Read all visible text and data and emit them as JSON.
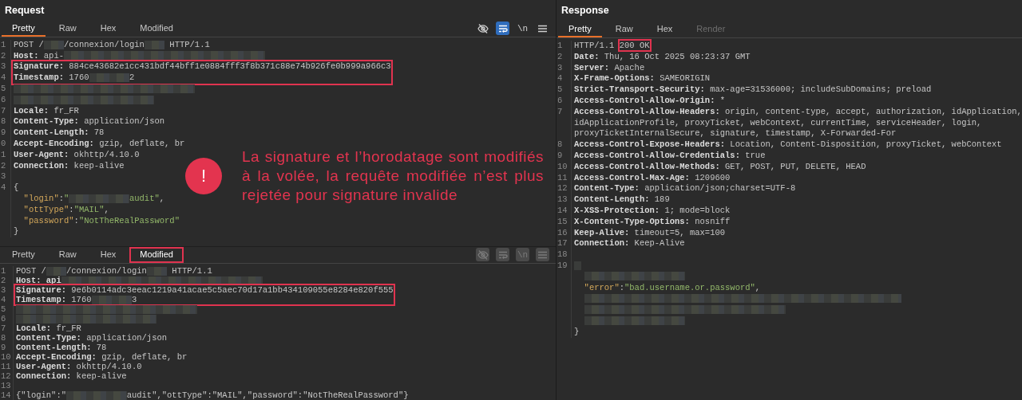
{
  "request": {
    "title": "Request",
    "tabs": [
      {
        "label": "Pretty",
        "selected": true,
        "highlighted": false
      },
      {
        "label": "Raw",
        "selected": false,
        "highlighted": false
      },
      {
        "label": "Hex",
        "selected": false,
        "highlighted": false
      },
      {
        "label": "Modified",
        "selected": false,
        "highlighted": false
      }
    ],
    "toolbar": {
      "disabled": false,
      "items": [
        {
          "kind": "eye_off",
          "active": false
        },
        {
          "kind": "wrap",
          "active": true
        },
        {
          "kind": "newline",
          "label": "\\n",
          "active": false
        },
        {
          "kind": "menu",
          "active": false
        }
      ]
    },
    "lines": [
      {
        "number": "1",
        "segments": [
          {
            "kind": "plain",
            "text": "POST /"
          },
          {
            "kind": "redacted_short"
          },
          {
            "kind": "plain",
            "text": "/connexion/login"
          },
          {
            "kind": "redacted_short"
          },
          {
            "kind": "plain",
            "text": " HTTP/1.1"
          }
        ]
      },
      {
        "number": "2",
        "segments": [
          {
            "kind": "name",
            "text": "Host:"
          },
          {
            "kind": "plain",
            "text": " api-"
          },
          {
            "kind": "redacted_huge"
          }
        ]
      },
      {
        "kind": "highlight_box",
        "lines": [
          {
            "number": "3",
            "segments": [
              {
                "kind": "name",
                "text": "Signature:"
              },
              {
                "kind": "plain",
                "text": " 884ce43682e1cc431bdf44bff1e0884fff3f8b371c88e74b926fe0b999a966c3"
              }
            ]
          },
          {
            "number": "4",
            "segments": [
              {
                "kind": "name",
                "text": "Timestamp:"
              },
              {
                "kind": "plain",
                "text": " 1760"
              },
              {
                "kind": "redacted_medium"
              },
              {
                "kind": "plain",
                "text": "2"
              }
            ]
          }
        ]
      },
      {
        "number": "5",
        "segments": [
          {
            "kind": "redacted_xwide"
          }
        ]
      },
      {
        "number": "6",
        "segments": [
          {
            "kind": "redacted_wide"
          }
        ]
      },
      {
        "number": "7",
        "segments": [
          {
            "kind": "name",
            "text": "Locale:"
          },
          {
            "kind": "plain",
            "text": " fr_FR"
          }
        ]
      },
      {
        "number": "8",
        "segments": [
          {
            "kind": "name",
            "text": "Content-Type:"
          },
          {
            "kind": "plain",
            "text": " application/json"
          }
        ]
      },
      {
        "number": "9",
        "segments": [
          {
            "kind": "name",
            "text": "Content-Length:"
          },
          {
            "kind": "plain",
            "text": " 78"
          }
        ]
      },
      {
        "number": "0",
        "segments": [
          {
            "kind": "name",
            "text": "Accept-Encoding:"
          },
          {
            "kind": "plain",
            "text": " gzip, deflate, br"
          }
        ]
      },
      {
        "number": "1",
        "segments": [
          {
            "kind": "name",
            "text": "User-Agent:"
          },
          {
            "kind": "plain",
            "text": " okhttp/4.10.0"
          }
        ]
      },
      {
        "number": "2",
        "segments": [
          {
            "kind": "name",
            "text": "Connection:"
          },
          {
            "kind": "plain",
            "text": " keep-alive"
          }
        ]
      },
      {
        "number": "3"
      },
      {
        "number": "4",
        "segments": [
          {
            "kind": "plain",
            "text": "{"
          }
        ],
        "children": [
          {
            "segments": [
              {
                "kind": "key",
                "text": "\"login\""
              },
              {
                "kind": "plain",
                "text": ":"
              },
              {
                "kind": "str",
                "text": "\""
              },
              {
                "kind": "redacted_long"
              },
              {
                "kind": "str",
                "text": "audit\""
              },
              {
                "kind": "plain",
                "text": ","
              }
            ]
          },
          {
            "segments": [
              {
                "kind": "key",
                "text": "\"ottType\""
              },
              {
                "kind": "plain",
                "text": ":"
              },
              {
                "kind": "str",
                "text": "\"MAIL\""
              },
              {
                "kind": "plain",
                "text": ","
              }
            ]
          },
          {
            "segments": [
              {
                "kind": "key",
                "text": "\"password\""
              },
              {
                "kind": "plain",
                "text": ":"
              },
              {
                "kind": "str",
                "text": "\"NotTheRealPassword\""
              }
            ]
          }
        ]
      },
      {
        "segments": [
          {
            "kind": "plain",
            "text": "}"
          }
        ]
      }
    ]
  },
  "callout": {
    "icon": "!",
    "text": "La signature et l’horodatage sont modifiés à la volée, la requête modifiée n’est plus rejetée pour signature invalide"
  },
  "modified_request": {
    "tabs": [
      {
        "label": "Pretty",
        "selected": false,
        "highlighted": false
      },
      {
        "label": "Raw",
        "selected": false,
        "highlighted": false
      },
      {
        "label": "Hex",
        "selected": false,
        "highlighted": false
      },
      {
        "label": "Modified",
        "selected": true,
        "highlighted": true
      }
    ],
    "toolbar": {
      "disabled": true,
      "items": [
        {
          "kind": "eye_off"
        },
        {
          "kind": "wrap"
        },
        {
          "kind": "newline",
          "label": "\\n"
        },
        {
          "kind": "menu"
        }
      ]
    },
    "lines": [
      {
        "number": "1",
        "segments": [
          {
            "kind": "plain",
            "text": "POST /"
          },
          {
            "kind": "redacted_short"
          },
          {
            "kind": "plain",
            "text": "/connexion/login"
          },
          {
            "kind": "redacted_short"
          },
          {
            "kind": "plain",
            "text": " HTTP/1.1"
          }
        ]
      },
      {
        "number": "2",
        "segments": [
          {
            "kind": "name",
            "text": "Host: api"
          },
          {
            "kind": "redacted_huge"
          }
        ]
      },
      {
        "kind": "highlight_box",
        "lines": [
          {
            "number": "3",
            "segments": [
              {
                "kind": "name",
                "text": "Signature:"
              },
              {
                "kind": "plain",
                "text": " 9e6b0114adc3eeac1219a41acae5c5aec70d17a1bb434109055e8284e820f555"
              }
            ]
          },
          {
            "number": "4",
            "segments": [
              {
                "kind": "name",
                "text": "Timestamp:"
              },
              {
                "kind": "plain",
                "text": " 1760"
              },
              {
                "kind": "redacted_medium"
              },
              {
                "kind": "plain",
                "text": "3"
              }
            ]
          }
        ]
      },
      {
        "number": "5",
        "segments": [
          {
            "kind": "redacted_xwide"
          }
        ]
      },
      {
        "number": "6",
        "segments": [
          {
            "kind": "redacted_wide"
          }
        ]
      },
      {
        "number": "7",
        "segments": [
          {
            "kind": "name",
            "text": "Locale:"
          },
          {
            "kind": "plain",
            "text": " fr_FR"
          }
        ]
      },
      {
        "number": "8",
        "segments": [
          {
            "kind": "name",
            "text": "Content-Type:"
          },
          {
            "kind": "plain",
            "text": " application/json"
          }
        ]
      },
      {
        "number": "9",
        "segments": [
          {
            "kind": "name",
            "text": "Content-Length:"
          },
          {
            "kind": "plain",
            "text": " 78"
          }
        ]
      },
      {
        "number": "10",
        "segments": [
          {
            "kind": "name",
            "text": "Accept-Encoding:"
          },
          {
            "kind": "plain",
            "text": " gzip, deflate, br"
          }
        ]
      },
      {
        "number": "11",
        "segments": [
          {
            "kind": "name",
            "text": "User-Agent:"
          },
          {
            "kind": "plain",
            "text": " okhttp/4.10.0"
          }
        ]
      },
      {
        "number": "12",
        "segments": [
          {
            "kind": "name",
            "text": "Connection:"
          },
          {
            "kind": "plain",
            "text": " keep-alive"
          }
        ]
      },
      {
        "number": "13"
      },
      {
        "number": "14",
        "segments": [
          {
            "kind": "plain",
            "text": "{\"login\":\""
          },
          {
            "kind": "redacted_long"
          },
          {
            "kind": "plain",
            "text": "audit\",\"ottType\":\"MAIL\",\"password\":\"NotTheRealPassword\"}"
          }
        ]
      }
    ]
  },
  "response": {
    "title": "Response",
    "tabs": [
      {
        "label": "Pretty",
        "selected": true,
        "disabled": false
      },
      {
        "label": "Raw",
        "selected": false,
        "disabled": false
      },
      {
        "label": "Hex",
        "selected": false,
        "disabled": false
      },
      {
        "label": "Render",
        "selected": false,
        "disabled": true
      }
    ],
    "lines": [
      {
        "number": "1",
        "segments": [
          {
            "kind": "plain",
            "text": "HTTP/1.1 "
          },
          {
            "kind": "marked",
            "text": "200 OK"
          }
        ]
      },
      {
        "number": "2",
        "segments": [
          {
            "kind": "name",
            "text": "Date:"
          },
          {
            "kind": "plain",
            "text": " Thu, 16 Oct 2025 08:23:37 GMT"
          }
        ]
      },
      {
        "number": "3",
        "segments": [
          {
            "kind": "name",
            "text": "Server:"
          },
          {
            "kind": "plain",
            "text": " Apache"
          }
        ]
      },
      {
        "number": "4",
        "segments": [
          {
            "kind": "name",
            "text": "X-Frame-Options:"
          },
          {
            "kind": "plain",
            "text": " SAMEORIGIN"
          }
        ]
      },
      {
        "number": "5",
        "segments": [
          {
            "kind": "name",
            "text": "Strict-Transport-Security:"
          },
          {
            "kind": "plain",
            "text": " max-age=31536000; includeSubDomains; preload"
          }
        ]
      },
      {
        "number": "6",
        "segments": [
          {
            "kind": "name",
            "text": "Access-Control-Allow-Origin:"
          },
          {
            "kind": "plain",
            "text": " *"
          }
        ]
      },
      {
        "number": "7",
        "segments": [
          {
            "kind": "name",
            "text": "Access-Control-Allow-Headers:"
          },
          {
            "kind": "plain",
            "text": " origin, content-type, accept, authorization, idApplication,"
          }
        ]
      },
      {
        "segments": [
          {
            "kind": "plain",
            "text": "idApplicationProfile, proxyTicket, webContext, currentTime, serviceHeader, login,"
          }
        ]
      },
      {
        "segments": [
          {
            "kind": "plain",
            "text": "proxyTicketInternalSecure, signature, timestamp, X-Forwarded-For"
          }
        ]
      },
      {
        "number": "8",
        "segments": [
          {
            "kind": "name",
            "text": "Access-Control-Expose-Headers:"
          },
          {
            "kind": "plain",
            "text": " Location, Content-Disposition, proxyTicket, webContext"
          }
        ]
      },
      {
        "number": "9",
        "segments": [
          {
            "kind": "name",
            "text": "Access-Control-Allow-Credentials:"
          },
          {
            "kind": "plain",
            "text": " true"
          }
        ]
      },
      {
        "number": "10",
        "segments": [
          {
            "kind": "name",
            "text": "Access-Control-Allow-Methods:"
          },
          {
            "kind": "plain",
            "text": " GET, POST, PUT, DELETE, HEAD"
          }
        ]
      },
      {
        "number": "11",
        "segments": [
          {
            "kind": "name",
            "text": "Access-Control-Max-Age:"
          },
          {
            "kind": "plain",
            "text": " 1209600"
          }
        ]
      },
      {
        "number": "12",
        "segments": [
          {
            "kind": "name",
            "text": "Content-Type:"
          },
          {
            "kind": "plain",
            "text": " application/json;charset=UTF-8"
          }
        ]
      },
      {
        "number": "13",
        "segments": [
          {
            "kind": "name",
            "text": "Content-Length:"
          },
          {
            "kind": "plain",
            "text": " 189"
          }
        ]
      },
      {
        "number": "14",
        "segments": [
          {
            "kind": "name",
            "text": "X-XSS-Protection:"
          },
          {
            "kind": "plain",
            "text": " 1; mode=block"
          }
        ]
      },
      {
        "number": "15",
        "segments": [
          {
            "kind": "name",
            "text": "X-Content-Type-Options:"
          },
          {
            "kind": "plain",
            "text": " nosniff"
          }
        ]
      },
      {
        "number": "16",
        "segments": [
          {
            "kind": "name",
            "text": "Keep-Alive:"
          },
          {
            "kind": "plain",
            "text": " timeout=5, max=100"
          }
        ]
      },
      {
        "number": "17",
        "segments": [
          {
            "kind": "name",
            "text": "Connection:"
          },
          {
            "kind": "plain",
            "text": " Keep-Alive"
          }
        ]
      },
      {
        "number": "18"
      },
      {
        "number": "19",
        "segments": [
          {
            "kind": "redacted_tiny"
          }
        ],
        "children": [
          {
            "segments": [
              {
                "kind": "redacted_xlong"
              }
            ]
          },
          {
            "segments": [
              {
                "kind": "key",
                "text": "\"error\""
              },
              {
                "kind": "plain",
                "text": ":"
              },
              {
                "kind": "str",
                "text": "\"bad.username.or.password\""
              },
              {
                "kind": "plain",
                "text": ","
              }
            ]
          },
          {
            "segments": [
              {
                "kind": "redacted_vast"
              }
            ]
          },
          {
            "segments": [
              {
                "kind": "redacted_huge"
              }
            ]
          },
          {
            "segments": [
              {
                "kind": "redacted_xlong"
              }
            ]
          }
        ]
      },
      {
        "segments": [
          {
            "kind": "plain",
            "text": "}"
          }
        ]
      }
    ]
  }
}
